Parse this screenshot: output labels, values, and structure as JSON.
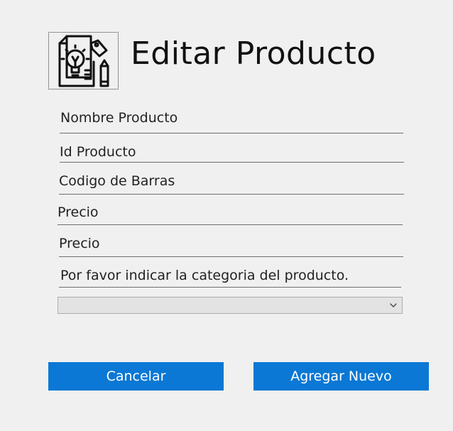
{
  "header": {
    "title": "Editar Producto",
    "logo_icon": "product-idea-document-icon"
  },
  "form": {
    "fields": [
      {
        "placeholder": "Nombre Producto"
      },
      {
        "placeholder": "Id Producto"
      },
      {
        "placeholder": "Codigo de Barras"
      },
      {
        "placeholder": "Precio"
      },
      {
        "placeholder": "Precio"
      },
      {
        "placeholder": "Por favor indicar la categoria del producto."
      }
    ],
    "category_select": {
      "selected": "",
      "icon": "chevron-down-icon"
    }
  },
  "actions": {
    "cancel_label": "Cancelar",
    "add_label": "Agregar Nuevo"
  },
  "colors": {
    "background": "#f0f0f0",
    "button": "#0a78d4",
    "button_text": "#ffffff"
  }
}
